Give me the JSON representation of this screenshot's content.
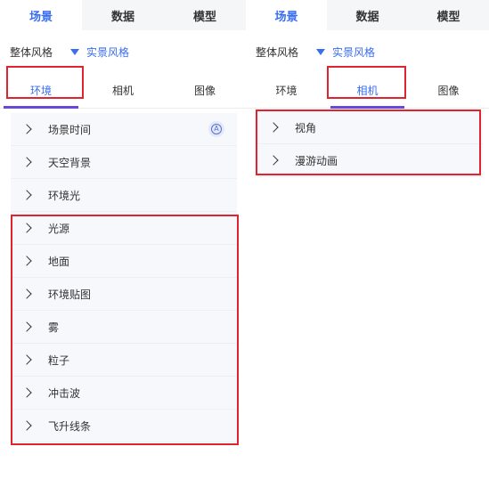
{
  "left": {
    "top_tabs": [
      "场景",
      "数据",
      "模型"
    ],
    "style_label": "整体风格",
    "style_value": "实景风格",
    "sub_tabs": [
      "环境",
      "相机",
      "图像"
    ],
    "items": [
      "场景时间",
      "天空背景",
      "环境光",
      "光源",
      "地面",
      "环境贴图",
      "雾",
      "粒子",
      "冲击波",
      "飞升线条"
    ],
    "badge_glyph": "A"
  },
  "right": {
    "top_tabs": [
      "场景",
      "数据",
      "模型"
    ],
    "style_label": "整体风格",
    "style_value": "实景风格",
    "sub_tabs": [
      "环境",
      "相机",
      "图像"
    ],
    "items": [
      "视角",
      "漫游动画"
    ]
  },
  "colors": {
    "accent": "#3a6df0",
    "underline": "#6a48d7",
    "highlight": "#e0242f"
  }
}
